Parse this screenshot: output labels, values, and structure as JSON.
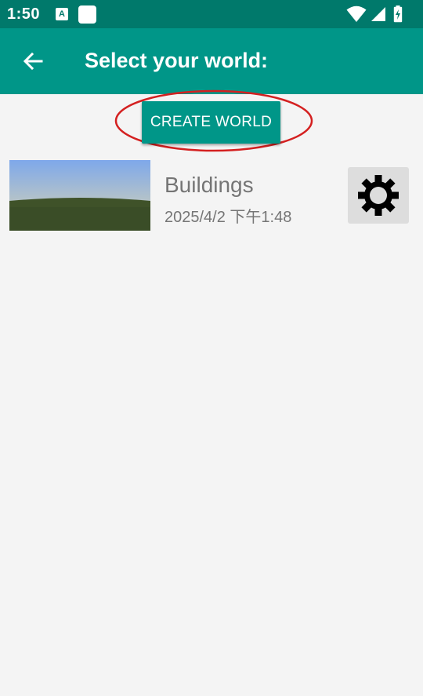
{
  "status_bar": {
    "time": "1:50",
    "notif_a_label": "A",
    "icons": [
      "notification-a-icon",
      "notification-square-icon",
      "wifi-icon",
      "cell-signal-icon",
      "battery-charging-icon"
    ]
  },
  "app_bar": {
    "title": "Select your world:",
    "back_icon": "arrow-back-icon"
  },
  "actions": {
    "create_world_label": "CREATE WORLD"
  },
  "worlds": [
    {
      "name": "Buildings",
      "date": "2025/4/2 下午1:48",
      "settings_icon": "gear-icon"
    }
  ],
  "colors": {
    "status_bar": "#00796b",
    "app_bar": "#009688",
    "accent": "#009688",
    "highlight": "#d42020",
    "background": "#f4f4f4"
  }
}
